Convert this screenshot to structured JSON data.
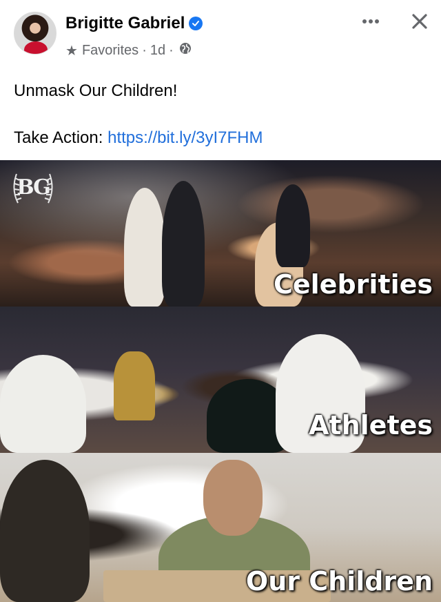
{
  "post": {
    "author_name": "Brigitte Gabriel",
    "audience": "Favorites",
    "time_ago": "1d",
    "text": "Unmask Our Children!",
    "action_label": "Take Action:",
    "action_link": "https://bit.ly/3yI7FHM"
  },
  "icons": {
    "verified": "verified-badge-icon",
    "favorites": "star-icon",
    "audience": "globe-icon",
    "more": "more-options-icon",
    "close": "close-icon"
  },
  "image": {
    "logo_text": "BG",
    "captions": [
      "Celebrities",
      "Athletes",
      "Our Children"
    ]
  },
  "colors": {
    "link": "#216fdb",
    "verified": "#1877f2",
    "meta_text": "#65676b"
  }
}
